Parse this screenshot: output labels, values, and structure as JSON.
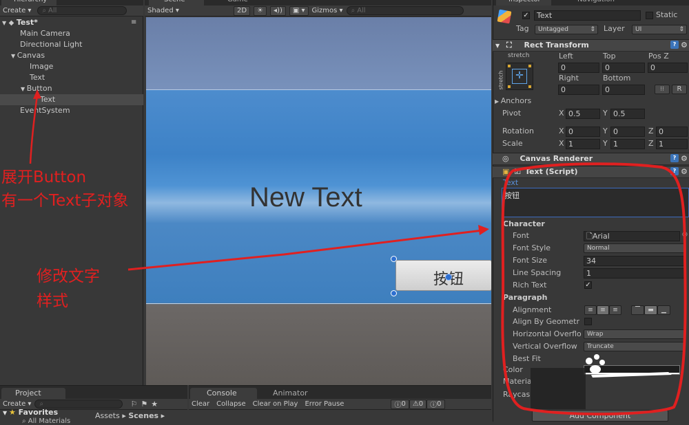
{
  "hierarchy": {
    "tab": "Hierarchy",
    "create": "Create",
    "search_placeholder": "All",
    "scene": "Test*",
    "items": [
      "Main Camera",
      "Directional Light",
      "Canvas",
      "Image",
      "Text",
      "Button",
      "Text",
      "EventSystem"
    ]
  },
  "scene_view": {
    "tab_scene": "Scene",
    "tab_game": "Game",
    "shading": "Shaded",
    "mode_2d": "2D",
    "gizmos": "Gizmos",
    "search_placeholder": "All",
    "new_text": "New Text",
    "button_text": "按钮"
  },
  "annotations": {
    "expand_line1": "展开Button",
    "expand_line2": "有一个Text子对象",
    "modify_line1": "修改文字",
    "modify_line2": "样式",
    "color": "#e02020"
  },
  "inspector": {
    "tab": "Inspector",
    "tab_nav": "Navigation",
    "object_name": "Text",
    "static_label": "Static",
    "tag_label": "Tag",
    "tag_value": "Untagged",
    "layer_label": "Layer",
    "layer_value": "UI",
    "rect_transform": {
      "title": "Rect Transform",
      "anchor_preset": "stretch",
      "anchor_side": "stretch",
      "left_label": "Left",
      "left": "0",
      "top_label": "Top",
      "top": "0",
      "posz_label": "Pos Z",
      "posz": "0",
      "right_label": "Right",
      "right": "0",
      "bottom_label": "Bottom",
      "bottom": "0",
      "r_button": "R",
      "anchors": "Anchors",
      "pivot_label": "Pivot",
      "pivot_x": "0.5",
      "pivot_y": "0.5",
      "rotation_label": "Rotation",
      "rot_x": "0",
      "rot_y": "0",
      "rot_z": "0",
      "scale_label": "Scale",
      "scale_x": "1",
      "scale_y": "1",
      "scale_z": "1",
      "x": "X",
      "y": "Y",
      "z": "Z"
    },
    "canvas_renderer": "Canvas Renderer",
    "text_script": {
      "title": "Text (Script)",
      "text_label": "Text",
      "text_value": "按钮",
      "character": "Character",
      "font_label": "Font",
      "font_value": "Arial",
      "font_style_label": "Font Style",
      "font_style_value": "Normal",
      "font_size_label": "Font Size",
      "font_size_value": "34",
      "line_spacing_label": "Line Spacing",
      "line_spacing_value": "1",
      "rich_text_label": "Rich Text",
      "paragraph": "Paragraph",
      "alignment_label": "Alignment",
      "align_by_geometry_label": "Align By Geometr",
      "h_overflow_label": "Horizontal Overflo",
      "h_overflow_value": "Wrap",
      "v_overflow_label": "Vertical Overflow",
      "v_overflow_value": "Truncate",
      "best_fit_label": "Best Fit",
      "color_label": "Color",
      "material_label": "Materia",
      "raycast_label": "Raycas",
      "add_component": "Add Component"
    }
  },
  "bottom": {
    "project_tab": "Project",
    "create": "Create",
    "favorites": "Favorites",
    "all_materials": "All Materials",
    "assets": "Assets",
    "scenes": "Scenes",
    "console_tab": "Console",
    "animator_tab": "Animator",
    "clear": "Clear",
    "collapse": "Collapse",
    "clear_on_play": "Clear on Play",
    "error_pause": "Error Pause",
    "count_info": "0",
    "count_warn": "0",
    "count_error": "0"
  }
}
